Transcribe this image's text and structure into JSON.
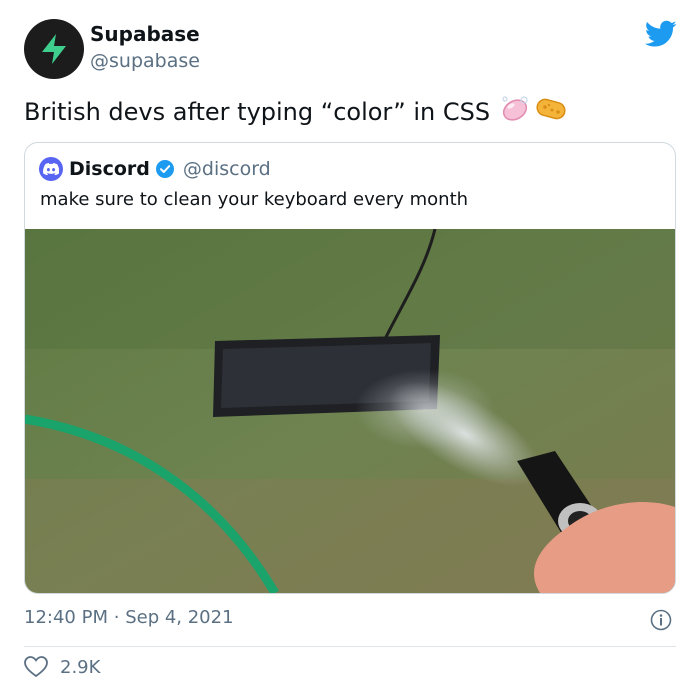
{
  "author": {
    "name": "Supabase",
    "handle": "@supabase",
    "avatar_icon": "supabase-logo-icon",
    "brand_color": "#3ecf8e"
  },
  "tweet": {
    "text": "British devs after typing “color” in CSS",
    "emojis": [
      "soap-icon",
      "sponge-icon"
    ]
  },
  "quoted": {
    "name": "Discord",
    "handle": "@discord",
    "verified": true,
    "text": "make sure to clean your keyboard every month",
    "media_icon": "keyboard-hose-photo"
  },
  "meta": {
    "time": "12:40 PM",
    "separator": "·",
    "date": "Sep 4, 2021"
  },
  "likes": {
    "count": "2.9K"
  },
  "colors": {
    "twitter_blue": "#1d9bf0",
    "discord_blurple": "#5865f2",
    "muted": "#5b7083"
  }
}
